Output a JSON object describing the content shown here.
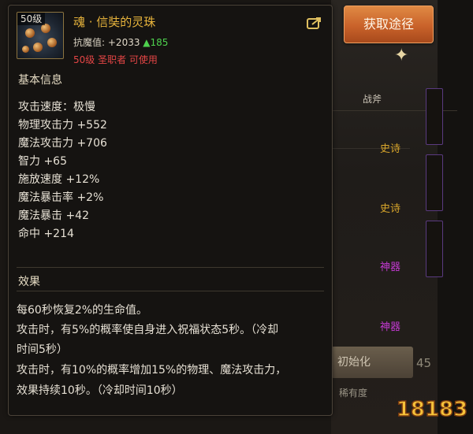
{
  "item": {
    "level_badge": "50级",
    "name": "魂 · 信奘的灵珠",
    "resist_label": "抗魔值:",
    "resist_value": "+2033",
    "resist_delta": "▲185",
    "requirement": "50级 圣职者 可使用"
  },
  "sections": {
    "basic_info": "基本信息",
    "effect": "效果"
  },
  "stats": [
    "攻击速度：极慢",
    "物理攻击力 +552",
    "魔法攻击力 +706",
    "智力 +65",
    "施放速度 +12%",
    "魔法暴击率 +2%",
    "魔法暴击 +42",
    "命中 +214"
  ],
  "effects": [
    "每60秒恢复2%的生命值。",
    "攻击时，有5%的概率使自身进入祝福状态5秒。（冷却",
    "时间5秒）",
    "攻击时，有10%的概率增加15%的物理、魔法攻击力，",
    "效果持续10秒。（冷却时间10秒）"
  ],
  "source_button": "获取途径",
  "background": {
    "column_header": "战斧",
    "tags": [
      "史诗",
      "史诗",
      "神器",
      "神器"
    ],
    "init_button": "初始化",
    "count": "45",
    "rarity_label": "稀有度"
  },
  "watermark": "18183",
  "colors": {
    "item_name": "#e8b43c",
    "requirement": "#e34545",
    "resist_up": "#4ed24e",
    "button": "#c9622a"
  },
  "icons": [
    "share-icon",
    "star-icon"
  ]
}
